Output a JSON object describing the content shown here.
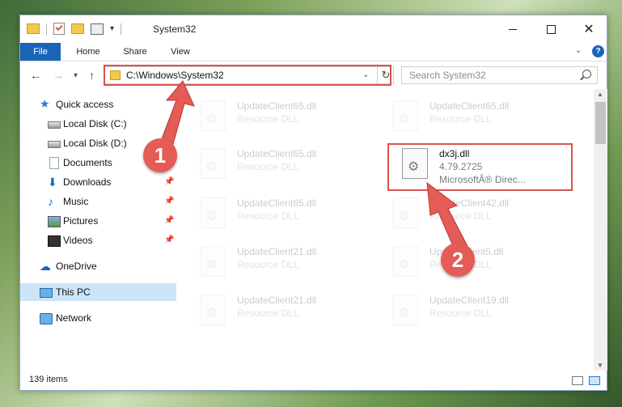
{
  "window": {
    "title": "System32",
    "controls": {
      "minimize": "minimize",
      "maximize": "maximize",
      "close": "✕"
    }
  },
  "ribbon": {
    "tabs": [
      "File",
      "Home",
      "Share",
      "View"
    ],
    "help": "?"
  },
  "navigation": {
    "address": "C:\\Windows\\System32",
    "search_placeholder": "Search System32"
  },
  "sidebar": {
    "items": [
      {
        "label": "Quick access",
        "icon": "star-icon",
        "pinned": false
      },
      {
        "label": "Local Disk (C:)",
        "icon": "disk-icon",
        "pinned": false
      },
      {
        "label": "Local Disk (D:)",
        "icon": "disk-icon",
        "pinned": false
      },
      {
        "label": "Documents",
        "icon": "documents-icon",
        "pinned": false
      },
      {
        "label": "Downloads",
        "icon": "download-icon",
        "pinned": true
      },
      {
        "label": "Music",
        "icon": "music-icon",
        "pinned": true
      },
      {
        "label": "Pictures",
        "icon": "pictures-icon",
        "pinned": true
      },
      {
        "label": "Videos",
        "icon": "videos-icon",
        "pinned": true
      },
      {
        "label": "OneDrive",
        "icon": "cloud-icon",
        "pinned": false
      },
      {
        "label": "This PC",
        "icon": "computer-icon",
        "pinned": false,
        "selected": true
      },
      {
        "label": "Network",
        "icon": "network-icon",
        "pinned": false
      }
    ]
  },
  "files": {
    "left": [
      {
        "name": "UpdateClient65.dll",
        "type": "Resource DLL"
      },
      {
        "name": "UpdateClient65.dll",
        "type": "Resource DLL"
      },
      {
        "name": "UpdateClient65.dll",
        "type": "Resource DLL"
      },
      {
        "name": "UpdateClient21.dll",
        "type": "Resource DLL"
      },
      {
        "name": "UpdateClient21.dll",
        "type": "Resource DLL"
      }
    ],
    "right": [
      {
        "name": "UpdateClient65.dll",
        "type": "Resource DLL"
      },
      {
        "name": "dx3j.dll",
        "version": "4.79.2725",
        "company": "MicrosoftÂ® Direc..."
      },
      {
        "name": "UpdateClient42.dll",
        "type": "Resource DLL"
      },
      {
        "name": "UpdateClient5.dll",
        "type": "Resource DLL"
      },
      {
        "name": "UpdateClient19.dll",
        "type": "Resource DLL"
      }
    ]
  },
  "status": {
    "item_count": "139 items"
  },
  "annotations": {
    "step1": "1",
    "step2": "2",
    "color": "#e55b55"
  }
}
